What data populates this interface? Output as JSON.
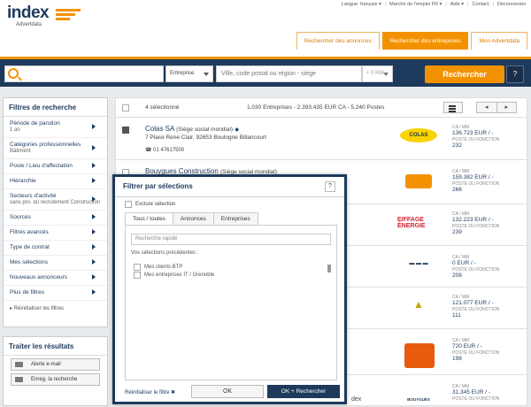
{
  "header": {
    "logo_text": "index",
    "logo_sub": "Advertdata",
    "top_links": [
      "Langue: français ▾",
      "Marché de l'emploi FR ▾",
      "Aide ▾",
      "Contact",
      "Déconnexion"
    ],
    "tabs": [
      {
        "label": "Rechercher des annonces",
        "active": false
      },
      {
        "label": "Rechercher des entreprises",
        "active": true
      },
      {
        "label": "Mon Advertdata",
        "active": false
      }
    ]
  },
  "search": {
    "type_value": "Entreprise",
    "location_placeholder": "Ville, code postal ou région - siège",
    "distance_value": "+ 0 KM",
    "button_label": "Rechercher",
    "help_label": "?"
  },
  "sidebar": {
    "title": "Filtres de recherche",
    "items": [
      {
        "label": "Période de parution",
        "sub": "1 an"
      },
      {
        "label": "Catégories professionnelles",
        "sub": "Bâtiment"
      },
      {
        "label": "Poste / Lieu d'affectation",
        "sub": ""
      },
      {
        "label": "Hiérarchie",
        "sub": ""
      },
      {
        "label": "Secteurs d'activité",
        "sub": "sans pro. du recrutement Construction"
      },
      {
        "label": "Sources",
        "sub": ""
      },
      {
        "label": "Filtres avancés",
        "sub": ""
      },
      {
        "label": "Type de contrat",
        "sub": ""
      },
      {
        "label": "Mes sélections",
        "sub": ""
      },
      {
        "label": "Nouveaux annonceurs",
        "sub": ""
      },
      {
        "label": "Plus de filtres",
        "sub": ""
      }
    ],
    "reset": "Réinitialiser les filtres"
  },
  "results_panel": {
    "title": "Traiter les résultats",
    "buttons": [
      "Alerte e-mail",
      "Enreg. la recherche"
    ]
  },
  "list": {
    "selected": "4 sélectionné",
    "stats": "1.030 Entreprises  -  2.393.435 EUR CA  -  5.240 Postes",
    "pager_prev": "◂",
    "pager_next": "▸",
    "rows": [
      {
        "name": "Colas SA",
        "ss": "(Siège social mondial)",
        "addr": "7 Place Rene Clair, 92653 Boulogne Billancourt",
        "tel": "01 47617500",
        "logo": "COLAS",
        "ca": "136.723 EUR / -",
        "postes": "232",
        "checked": true
      },
      {
        "name": "Bouygues Construction",
        "ss": "(Siège social mondial)",
        "addr": "",
        "tel": "",
        "logo": "",
        "ca": "159.382 EUR / -",
        "postes": "266",
        "checked": false
      },
      {
        "name": "",
        "ss": "",
        "addr": "",
        "tel": "",
        "logo": "EIFFAGE ÉNERGIE",
        "ca": "132.223 EUR / -",
        "postes": "239",
        "checked": false
      },
      {
        "name": "",
        "ss": "",
        "addr": "",
        "tel": "",
        "logo": "",
        "ca": "0 EUR / -",
        "postes": "208",
        "checked": false
      },
      {
        "name": "",
        "ss": "",
        "addr": "",
        "tel": "",
        "logo": "",
        "ca": "121.077 EUR / -",
        "postes": "111",
        "checked": false
      },
      {
        "name": "",
        "ss": "",
        "addr": "",
        "tel": "",
        "logo": "",
        "ca": "720 EUR / -",
        "postes": "198",
        "checked": false
      },
      {
        "name": "",
        "ss": "",
        "addr": "",
        "tel": "",
        "logo": "BOUYGUES",
        "ca": "31.345 EUR / -",
        "postes": "",
        "checked": false
      }
    ],
    "ca_label": "CA / MM",
    "postes_label": "POSTE OU FONCTION"
  },
  "overlay": {
    "title": "Filtrer par sélections",
    "help": "?",
    "exclude": "Exclure sélection",
    "tabs": [
      {
        "label": "Tous / toutes",
        "active": true
      },
      {
        "label": "Annonces",
        "active": false
      },
      {
        "label": "Entreprises",
        "active": false
      }
    ],
    "quick_placeholder": "Recherche rapide",
    "prev_label": "Vos sélections précédentes :",
    "items": [
      "Mes clients BTP",
      "Mes entreprises IT / Grenoble"
    ],
    "reset": "Réinitialiser le filtre ✖",
    "ok": "OK",
    "ok_search": "OK + Rechercher"
  },
  "colors": {
    "navy": "#1d3a5c",
    "orange": "#f39200"
  }
}
